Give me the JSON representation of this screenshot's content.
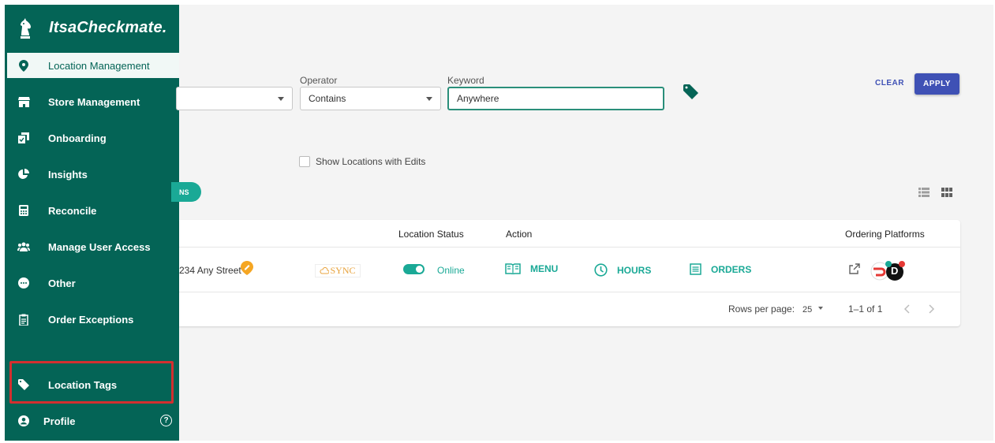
{
  "brand": {
    "name": "ItsaCheckmate."
  },
  "nav": [
    {
      "label": "Location Management",
      "icon": "location-pin-icon",
      "active": true
    },
    {
      "label": "Store Management",
      "icon": "store-icon"
    },
    {
      "label": "Onboarding",
      "icon": "onboarding-icon"
    },
    {
      "label": "Insights",
      "icon": "pie-chart-icon"
    },
    {
      "label": "Reconcile",
      "icon": "calculator-icon"
    },
    {
      "label": "Manage User Access",
      "icon": "users-icon"
    },
    {
      "label": "Other",
      "icon": "more-icon"
    },
    {
      "label": "Order Exceptions",
      "icon": "clipboard-icon"
    },
    {
      "label": "Location Tags",
      "icon": "tag-icon"
    },
    {
      "label": "Profile",
      "icon": "user-icon"
    }
  ],
  "help_label": "?",
  "filters": {
    "operator_label": "Operator",
    "operator_value": "Contains",
    "keyword_label": "Keyword",
    "keyword_value": "Anywhere",
    "clear_label": "CLEAR",
    "apply_label": "APPLY",
    "show_edits_label": "Show Locations with Edits",
    "pill_label": "NS"
  },
  "table": {
    "headers": {
      "status": "Location Status",
      "action": "Action",
      "platforms": "Ordering Platforms"
    },
    "row": {
      "address": "234 Any Street",
      "pos": "SYNC",
      "status": "Online",
      "menu": "MENU",
      "hours": "HOURS",
      "orders": "ORDERS",
      "platform_logo": "D"
    },
    "pager": {
      "rows_per_page_label": "Rows per page:",
      "rows_per_page": "25",
      "range": "1–1 of 1"
    }
  },
  "colors": {
    "sidebar": "#046456",
    "accent": "#1aa996",
    "primary": "#3f51b5",
    "highlight": "#d32f2f"
  }
}
